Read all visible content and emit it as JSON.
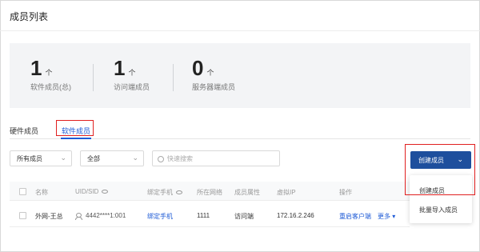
{
  "page": {
    "title": "成员列表"
  },
  "stats": [
    {
      "value": "1",
      "unit": "个",
      "label": "软件成员(总)"
    },
    {
      "value": "1",
      "unit": "个",
      "label": "访问端成员"
    },
    {
      "value": "0",
      "unit": "个",
      "label": "服务器端成员"
    }
  ],
  "tabs": [
    {
      "label": "硬件成员",
      "active": false
    },
    {
      "label": "软件成员",
      "active": true
    }
  ],
  "filters": {
    "member_select": "所有成员",
    "scope_select": "全部",
    "search_placeholder": "快速搜索"
  },
  "create_button": {
    "label": "创建成员"
  },
  "create_menu": [
    "创建成员",
    "批量导入成员"
  ],
  "table": {
    "columns": [
      "名称",
      "UID/SID",
      "绑定手机",
      "所在网络",
      "成员属性",
      "虚拟IP",
      "操作"
    ],
    "rows": [
      {
        "name": "外网-王总",
        "uid": "4442****1:001",
        "phone": "绑定手机",
        "network": "1111",
        "attribute": "访问端",
        "vip": "172.16.2.246",
        "action_primary": "重启客户端",
        "action_more": "更多"
      }
    ]
  },
  "colors": {
    "accent": "#1f5bd6",
    "button": "#1e4f9d",
    "highlight": "#e02020"
  }
}
